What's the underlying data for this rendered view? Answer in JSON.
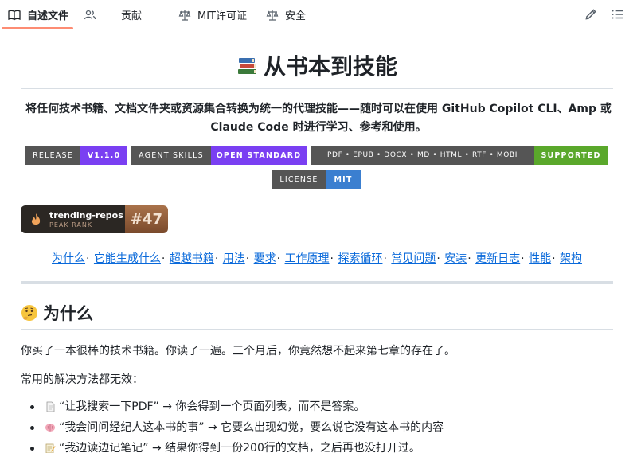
{
  "tabs": [
    {
      "label": "自述文件",
      "icon": "book-icon",
      "active": true
    },
    {
      "label": "",
      "icon": "people-icon"
    },
    {
      "label": "贡献",
      "icon": ""
    },
    {
      "label": "MIT许可证",
      "icon": "scale-icon"
    },
    {
      "label": "安全",
      "icon": "scale-icon"
    }
  ],
  "toolbar": {
    "edit_icon": "pencil-icon",
    "outline_icon": "list-icon"
  },
  "title": "从书本到技能",
  "title_emoji": "books-icon",
  "description": "将任何技术书籍、文档文件夹或资源集合转换为统一的代理技能——随时可以在使用 GitHub Copilot CLI、Amp 或 Claude Code 时进行学习、参考和使用。",
  "badges": [
    {
      "left": "RELEASE",
      "right": "V1.1.0",
      "color": "#7a3ff2"
    },
    {
      "left": "AGENT SKILLS",
      "right": "OPEN STANDARD",
      "color": "#7a3ff2"
    },
    {
      "left": "PDF • EPUB • DOCX • MD • HTML • RTF • MOBI",
      "right": "SUPPORTED",
      "color": "#5aa82b"
    },
    {
      "left": "LICENSE",
      "right": "MIT",
      "color": "#3b7fd0"
    }
  ],
  "trending": {
    "name": "trending-repos",
    "sub": "PEAK RANK",
    "rank": "#47"
  },
  "nav_links": [
    "为什么",
    "它能生成什么",
    "超越书籍",
    "用法",
    "要求",
    "工作原理",
    "探索循环",
    "常见问题",
    "安装",
    "更新日志",
    "性能",
    "架构"
  ],
  "section": {
    "heading": "为什么",
    "emoji": "thinking-face-icon"
  },
  "paragraphs": [
    "你买了一本很棒的技术书籍。你读了一遍。三个月后，你竟然想不起来第七章的存在了。",
    "常用的解决方法都无效："
  ],
  "bullets": [
    {
      "icon": "page-icon",
      "text": "“让我搜索一下PDF” → 你会得到一个页面列表，而不是答案。"
    },
    {
      "icon": "brain-icon",
      "text": "“我会问问经纪人这本书的事” → 它要么出现幻觉，要么说它没有这本书的内容"
    },
    {
      "icon": "memo-icon",
      "text": "“我边读边记笔记” → 结果你得到一份200行的文档，之后再也没打开过。"
    }
  ]
}
